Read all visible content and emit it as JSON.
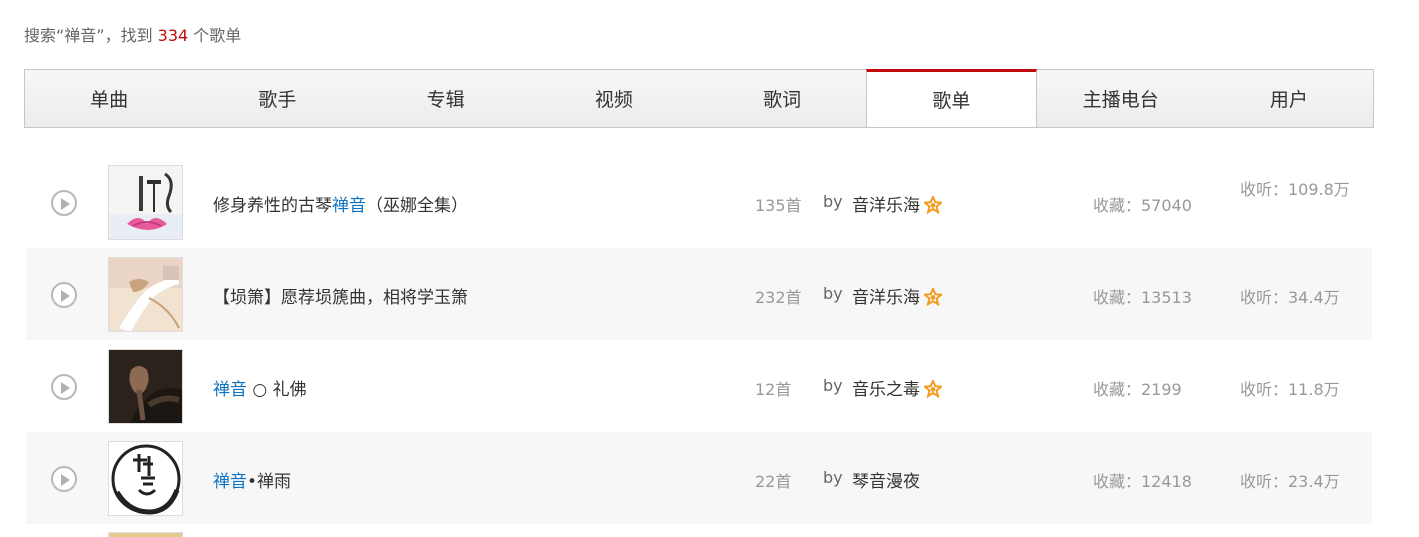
{
  "summary": {
    "prefix": "搜索“禅音”，找到 ",
    "count": "334",
    "suffix": " 个歌单"
  },
  "tabs": [
    {
      "label": "单曲"
    },
    {
      "label": "歌手"
    },
    {
      "label": "专辑"
    },
    {
      "label": "视频"
    },
    {
      "label": "歌词"
    },
    {
      "label": "歌单",
      "active": true
    },
    {
      "label": "主播电台"
    },
    {
      "label": "用户"
    }
  ],
  "playlists": [
    {
      "title_pre": "修身养性的古琴",
      "title_hl": "禅音",
      "title_post": "（巫娜全集）",
      "tracks": "135首",
      "by": "by",
      "creator": "音洋乐海",
      "star": true,
      "favorites": "收藏：57040",
      "plays": "收听：109.8万"
    },
    {
      "title_pre": "【埙箫】愿荐埙篪曲，相将学玉箫",
      "title_hl": "",
      "title_post": "",
      "tracks": "232首",
      "by": "by",
      "creator": "音洋乐海",
      "star": true,
      "favorites": "收藏：13513",
      "plays": "收听：34.4万"
    },
    {
      "title_pre": "",
      "title_hl": "禅音",
      "title_post": " ○ 礼佛",
      "tracks": "12首",
      "by": "by",
      "creator": "音乐之毒",
      "star": true,
      "favorites": "收藏：2199",
      "plays": "收听：11.8万"
    },
    {
      "title_pre": "",
      "title_hl": "禅音",
      "title_post": "•禅雨",
      "tracks": "22首",
      "by": "by",
      "creator": "琴音漫夜",
      "star": false,
      "favorites": "收藏：12418",
      "plays": "收听：23.4万"
    }
  ],
  "icons": {
    "play": "play-circle-icon",
    "star": "star-badge-icon"
  },
  "colors": {
    "accent_red": "#c20c0c",
    "highlight_blue": "#0c73c2",
    "star_orange": "#f29b1d"
  }
}
